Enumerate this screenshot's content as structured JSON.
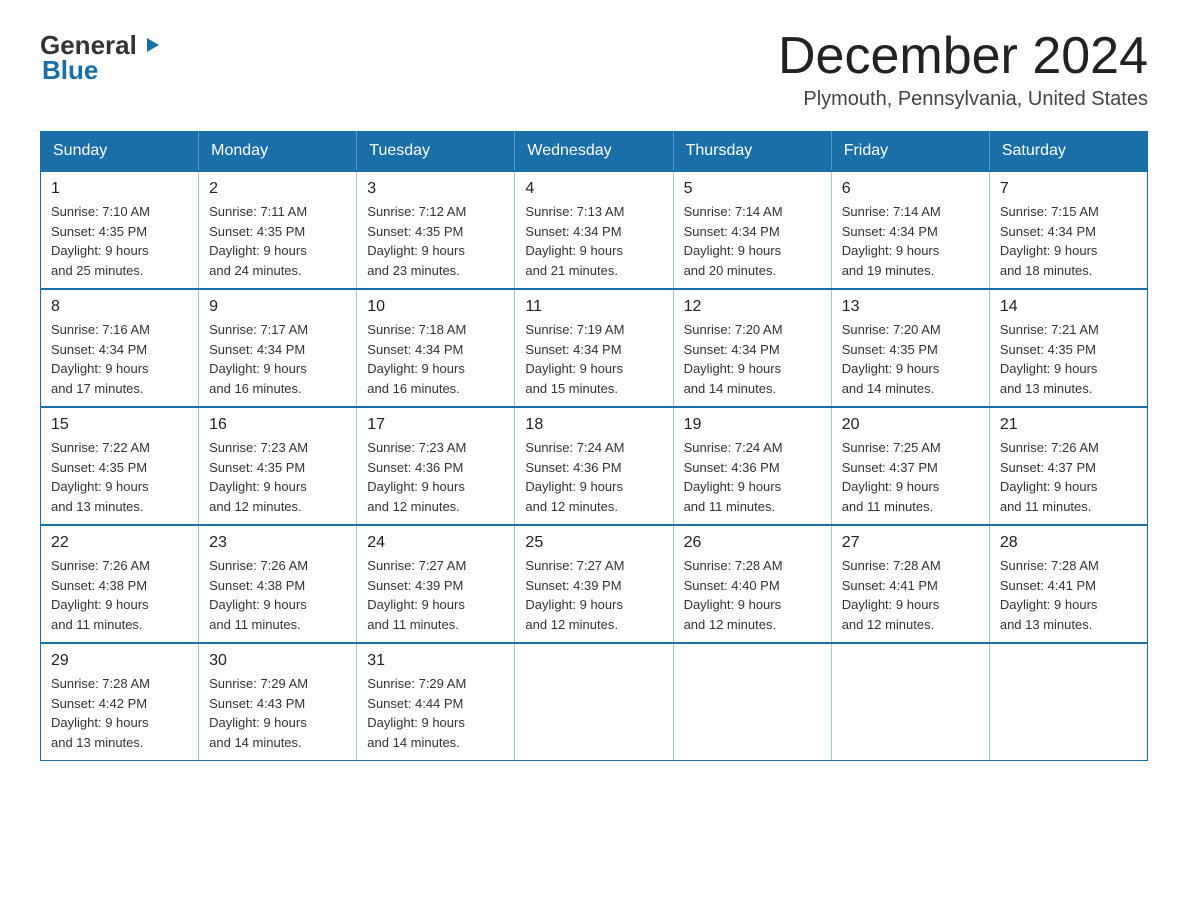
{
  "header": {
    "logo_general": "General",
    "logo_blue": "Blue",
    "month_title": "December 2024",
    "location": "Plymouth, Pennsylvania, United States"
  },
  "days_of_week": [
    "Sunday",
    "Monday",
    "Tuesday",
    "Wednesday",
    "Thursday",
    "Friday",
    "Saturday"
  ],
  "weeks": [
    [
      {
        "day": "1",
        "sunrise": "7:10 AM",
        "sunset": "4:35 PM",
        "daylight": "9 hours and 25 minutes."
      },
      {
        "day": "2",
        "sunrise": "7:11 AM",
        "sunset": "4:35 PM",
        "daylight": "9 hours and 24 minutes."
      },
      {
        "day": "3",
        "sunrise": "7:12 AM",
        "sunset": "4:35 PM",
        "daylight": "9 hours and 23 minutes."
      },
      {
        "day": "4",
        "sunrise": "7:13 AM",
        "sunset": "4:34 PM",
        "daylight": "9 hours and 21 minutes."
      },
      {
        "day": "5",
        "sunrise": "7:14 AM",
        "sunset": "4:34 PM",
        "daylight": "9 hours and 20 minutes."
      },
      {
        "day": "6",
        "sunrise": "7:14 AM",
        "sunset": "4:34 PM",
        "daylight": "9 hours and 19 minutes."
      },
      {
        "day": "7",
        "sunrise": "7:15 AM",
        "sunset": "4:34 PM",
        "daylight": "9 hours and 18 minutes."
      }
    ],
    [
      {
        "day": "8",
        "sunrise": "7:16 AM",
        "sunset": "4:34 PM",
        "daylight": "9 hours and 17 minutes."
      },
      {
        "day": "9",
        "sunrise": "7:17 AM",
        "sunset": "4:34 PM",
        "daylight": "9 hours and 16 minutes."
      },
      {
        "day": "10",
        "sunrise": "7:18 AM",
        "sunset": "4:34 PM",
        "daylight": "9 hours and 16 minutes."
      },
      {
        "day": "11",
        "sunrise": "7:19 AM",
        "sunset": "4:34 PM",
        "daylight": "9 hours and 15 minutes."
      },
      {
        "day": "12",
        "sunrise": "7:20 AM",
        "sunset": "4:34 PM",
        "daylight": "9 hours and 14 minutes."
      },
      {
        "day": "13",
        "sunrise": "7:20 AM",
        "sunset": "4:35 PM",
        "daylight": "9 hours and 14 minutes."
      },
      {
        "day": "14",
        "sunrise": "7:21 AM",
        "sunset": "4:35 PM",
        "daylight": "9 hours and 13 minutes."
      }
    ],
    [
      {
        "day": "15",
        "sunrise": "7:22 AM",
        "sunset": "4:35 PM",
        "daylight": "9 hours and 13 minutes."
      },
      {
        "day": "16",
        "sunrise": "7:23 AM",
        "sunset": "4:35 PM",
        "daylight": "9 hours and 12 minutes."
      },
      {
        "day": "17",
        "sunrise": "7:23 AM",
        "sunset": "4:36 PM",
        "daylight": "9 hours and 12 minutes."
      },
      {
        "day": "18",
        "sunrise": "7:24 AM",
        "sunset": "4:36 PM",
        "daylight": "9 hours and 12 minutes."
      },
      {
        "day": "19",
        "sunrise": "7:24 AM",
        "sunset": "4:36 PM",
        "daylight": "9 hours and 11 minutes."
      },
      {
        "day": "20",
        "sunrise": "7:25 AM",
        "sunset": "4:37 PM",
        "daylight": "9 hours and 11 minutes."
      },
      {
        "day": "21",
        "sunrise": "7:26 AM",
        "sunset": "4:37 PM",
        "daylight": "9 hours and 11 minutes."
      }
    ],
    [
      {
        "day": "22",
        "sunrise": "7:26 AM",
        "sunset": "4:38 PM",
        "daylight": "9 hours and 11 minutes."
      },
      {
        "day": "23",
        "sunrise": "7:26 AM",
        "sunset": "4:38 PM",
        "daylight": "9 hours and 11 minutes."
      },
      {
        "day": "24",
        "sunrise": "7:27 AM",
        "sunset": "4:39 PM",
        "daylight": "9 hours and 11 minutes."
      },
      {
        "day": "25",
        "sunrise": "7:27 AM",
        "sunset": "4:39 PM",
        "daylight": "9 hours and 12 minutes."
      },
      {
        "day": "26",
        "sunrise": "7:28 AM",
        "sunset": "4:40 PM",
        "daylight": "9 hours and 12 minutes."
      },
      {
        "day": "27",
        "sunrise": "7:28 AM",
        "sunset": "4:41 PM",
        "daylight": "9 hours and 12 minutes."
      },
      {
        "day": "28",
        "sunrise": "7:28 AM",
        "sunset": "4:41 PM",
        "daylight": "9 hours and 13 minutes."
      }
    ],
    [
      {
        "day": "29",
        "sunrise": "7:28 AM",
        "sunset": "4:42 PM",
        "daylight": "9 hours and 13 minutes."
      },
      {
        "day": "30",
        "sunrise": "7:29 AM",
        "sunset": "4:43 PM",
        "daylight": "9 hours and 14 minutes."
      },
      {
        "day": "31",
        "sunrise": "7:29 AM",
        "sunset": "4:44 PM",
        "daylight": "9 hours and 14 minutes."
      },
      null,
      null,
      null,
      null
    ]
  ],
  "labels": {
    "sunrise": "Sunrise:",
    "sunset": "Sunset:",
    "daylight": "Daylight: 9 hours"
  }
}
